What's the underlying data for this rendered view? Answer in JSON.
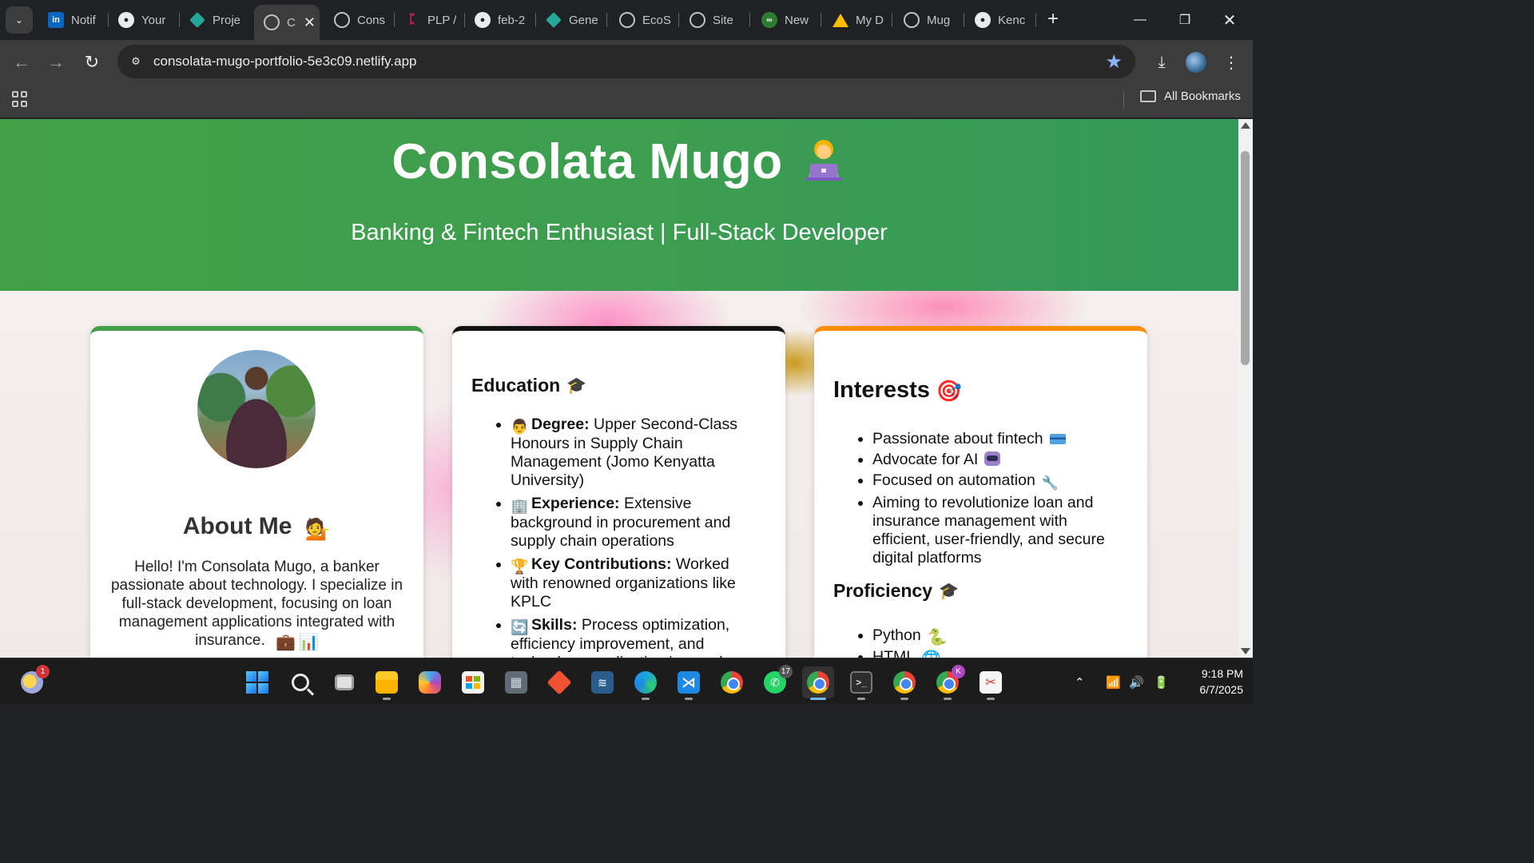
{
  "browser": {
    "tabs": [
      {
        "label": "Notif",
        "icon": "linkedin-icon"
      },
      {
        "label": "Your",
        "icon": "github-icon"
      },
      {
        "label": "Proje",
        "icon": "diamond-icon"
      },
      {
        "label": "C",
        "icon": "globe-icon",
        "active": true
      },
      {
        "label": "Cons",
        "icon": "globe-icon"
      },
      {
        "label": "PLP /",
        "icon": "plp-icon"
      },
      {
        "label": "feb-2",
        "icon": "github-icon"
      },
      {
        "label": "Gene",
        "icon": "diamond-icon"
      },
      {
        "label": "EcoS",
        "icon": "globe-icon"
      },
      {
        "label": "Site",
        "icon": "globe-icon"
      },
      {
        "label": "New",
        "icon": "new-icon"
      },
      {
        "label": "My D",
        "icon": "drive-icon"
      },
      {
        "label": "Mug",
        "icon": "globe-icon"
      },
      {
        "label": "Kenc",
        "icon": "github-icon"
      }
    ],
    "url": "consolata-mugo-portfolio-5e3c09.netlify.app",
    "bookmarks_label": "All Bookmarks"
  },
  "page": {
    "name": "Consolata Mugo",
    "tagline": "Banking & Fintech Enthusiast | Full-Stack Developer",
    "about": {
      "title": "About Me",
      "text": "Hello! I'm Consolata Mugo, a banker passionate about technology. I specialize in full-stack development, focusing on loan management applications integrated with insurance."
    },
    "education": {
      "title": "Education",
      "items": [
        {
          "label": "Degree:",
          "text": "Upper Second-Class Honours in Supply Chain Management (Jomo Kenyatta University)"
        },
        {
          "label": "Experience:",
          "text": "Extensive background in procurement and supply chain operations"
        },
        {
          "label": "Key Contributions:",
          "text": "Worked with renowned organizations like KPLC"
        },
        {
          "label": "Skills:",
          "text": "Process optimization, efficiency improvement, and technology application in supply chain"
        }
      ]
    },
    "interests": {
      "title": "Interests",
      "items": [
        "Passionate about fintech",
        "Advocate for AI",
        "Focused on automation",
        "Aiming to revolutionize loan and insurance management with efficient, user-friendly, and secure digital platforms"
      ]
    },
    "proficiency": {
      "title": "Proficiency",
      "items": [
        "Python",
        "HTML"
      ]
    }
  },
  "taskbar": {
    "weather_badge": "1",
    "whatsapp_badge": "17",
    "profile_badge": "K",
    "time": "9:18 PM",
    "date": "6/7/2025"
  }
}
